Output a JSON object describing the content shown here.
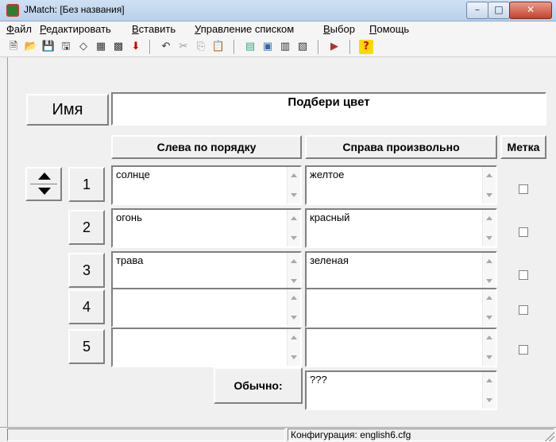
{
  "window": {
    "title": "JMatch: [Без названия]",
    "controls": {
      "minimize": "–",
      "maximize": "□",
      "close": "✕"
    }
  },
  "menu": [
    {
      "label": "Файл",
      "underline": "Ф",
      "rest": "айл"
    },
    {
      "label": "Редактировать",
      "underline": "Р",
      "rest": "едактировать"
    },
    {
      "label": "Вставить",
      "underline": "В",
      "rest": "ставить"
    },
    {
      "label": "Управление списком",
      "underline": "У",
      "rest": "правление списком"
    },
    {
      "label": "Выбор",
      "underline": "В",
      "rest": "ыбор"
    },
    {
      "label": "Помощь",
      "underline": "П",
      "rest": "омощь"
    }
  ],
  "toolbar": {
    "icons": [
      "new-icon",
      "open-icon",
      "save-icon",
      "save-as-icon",
      "eraser-icon",
      "web-export-icon",
      "web-export-2-icon",
      "drop-icon",
      "undo-icon",
      "cut-icon",
      "copy-icon",
      "paste-icon",
      "tool-1-icon",
      "tool-2-icon",
      "tool-3-icon",
      "tool-4-icon",
      "config-icon",
      "help-icon"
    ],
    "glyphs": [
      "🗎",
      "📂",
      "💾",
      "🖫",
      "◇",
      "▦",
      "▩",
      "⬇",
      "↶",
      "✂",
      "⎘",
      "📋",
      "▤",
      "▣",
      "▥",
      "▧",
      "▶",
      "?"
    ]
  },
  "form": {
    "name_button": "Имя",
    "exercise_title": "Подбери цвет",
    "header_left": "Слева по порядку",
    "header_right": "Справа произвольно",
    "header_mark": "Метка",
    "rows": [
      {
        "num": "1",
        "left": "солнце",
        "right": "желтое",
        "checked": false
      },
      {
        "num": "2",
        "left": "огонь",
        "right": "красный",
        "checked": false
      },
      {
        "num": "3",
        "left": "трава",
        "right": "зеленая",
        "checked": false
      },
      {
        "num": "4",
        "left": "",
        "right": "",
        "checked": false
      },
      {
        "num": "5",
        "left": "",
        "right": "",
        "checked": false
      }
    ],
    "default_button": "Обычно:",
    "default_value": "???"
  },
  "status": {
    "config": "Конфигурация: english6.cfg"
  },
  "colors": {
    "titlebar": "#c4d8ee",
    "close_button": "#c24330",
    "background": "#f0f0f0"
  }
}
